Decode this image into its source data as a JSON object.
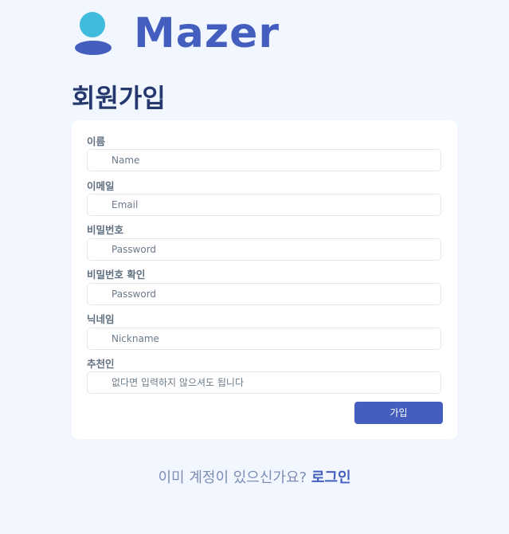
{
  "brand": {
    "name": "Mazer",
    "logo_icon": "user-avatar-icon",
    "color": "#435ebe",
    "accent_head": "#41bbdd"
  },
  "page": {
    "title": "회원가입"
  },
  "form": {
    "fields": [
      {
        "label": "이름",
        "placeholder": "Name",
        "value": ""
      },
      {
        "label": "이메일",
        "placeholder": "Email",
        "value": ""
      },
      {
        "label": "비밀번호",
        "placeholder": "Password",
        "value": ""
      },
      {
        "label": "비밀번호 확인",
        "placeholder": "Password",
        "value": ""
      },
      {
        "label": "닉네임",
        "placeholder": "Nickname",
        "value": ""
      },
      {
        "label": "추천인",
        "placeholder": "없다면 입력하지 않으셔도 됩니다",
        "value": ""
      }
    ],
    "submit_label": "가입"
  },
  "footer": {
    "prompt": "이미 계정이 있으신가요?",
    "login_link": "로그인"
  },
  "colors": {
    "background": "#f2f7ff",
    "card": "#ffffff",
    "title": "#25396f",
    "label": "#607080",
    "input_border": "#dce7f1",
    "primary": "#435ebe"
  }
}
